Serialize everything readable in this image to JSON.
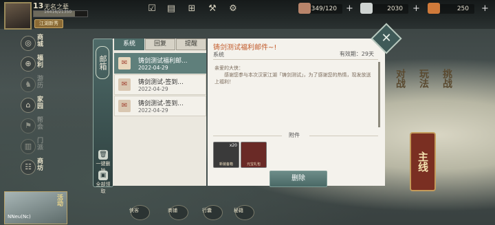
{
  "player": {
    "level": "13",
    "name": "无名之辈",
    "exp": "16416/21350",
    "exp_fraction": 0.77,
    "title": "江湖新秀"
  },
  "top_icons": [
    "task-icon",
    "document-icon",
    "calendar-icon",
    "tools-icon",
    "gear-icon"
  ],
  "resources": [
    {
      "name": "book-resource",
      "value": "349/120",
      "color": "#b8846a"
    },
    {
      "name": "silver-resource",
      "value": "2030",
      "color": "#cfd4d2"
    },
    {
      "name": "gold-resource",
      "value": "250",
      "color": "#d07a3a"
    }
  ],
  "left_nav": [
    {
      "label": "商城",
      "icon": "◎",
      "active": true
    },
    {
      "label": "福利",
      "icon": "⊕",
      "active": true
    },
    {
      "label": "游历",
      "icon": "♞",
      "active": false
    },
    {
      "label": "家园",
      "icon": "⌂",
      "active": true
    },
    {
      "label": "帮会",
      "icon": "⚑",
      "active": false
    },
    {
      "label": "门派",
      "icon": "▥",
      "active": false
    },
    {
      "label": "商坊",
      "icon": "☷",
      "active": true
    }
  ],
  "top_side_badge": "推荐",
  "character_card": {
    "label": "NNeu(Nc)",
    "side_label": "活动"
  },
  "bottom_nav": [
    "侠客",
    "商铺",
    "行囊",
    "秘籍"
  ],
  "right_menu": [
    "对战",
    "玩法",
    "挑战"
  ],
  "main_quest": "主线",
  "mail": {
    "tab_label": "邮箱",
    "delete_all": "一键删除",
    "claim_all": "全部领取",
    "tabs": [
      {
        "label": "系统",
        "active": true
      },
      {
        "label": "回复",
        "active": false
      },
      {
        "label": "提醒",
        "active": false
      }
    ],
    "items": [
      {
        "title": "铸剑测试福利邮...",
        "date": "2022-04-29",
        "active": true
      },
      {
        "title": "铸剑测试-签到...",
        "date": "2022-04-29",
        "active": false
      },
      {
        "title": "铸剑测试-签到...",
        "date": "2022-04-29",
        "active": false
      }
    ],
    "detail": {
      "title": "铸剑测试福利邮件~!",
      "sender": "系统",
      "validity": "有效期：29天",
      "body_greeting": "亲爱的大侠：",
      "body_text": "感谢您参与本次汉家江湖「铸剑测试」，为了感谢您的热情，现发放送上福利！",
      "attachment_label": "附件",
      "attachments": [
        {
          "name": "新装备箱",
          "count": "x20",
          "color": "#3a3a3a"
        },
        {
          "name": "元宝礼包",
          "count": "",
          "color": "#6a2a26"
        }
      ],
      "delete_label": "删除"
    }
  }
}
